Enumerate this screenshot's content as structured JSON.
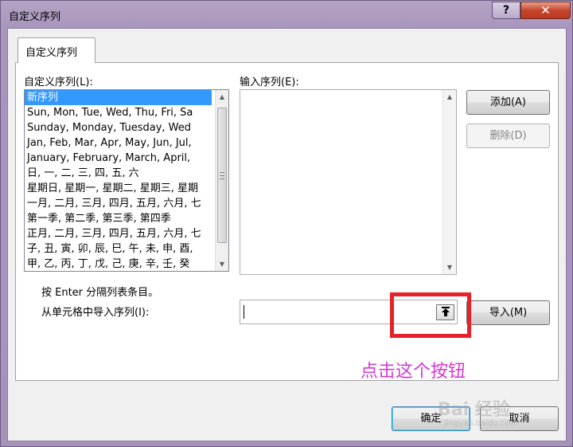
{
  "window": {
    "title": "自定义序列",
    "help_label": "?",
    "close_label": "✕"
  },
  "tab": {
    "label": "自定义序列"
  },
  "custom_list": {
    "label": "自定义序列(L):",
    "items": [
      "新序列",
      "Sun, Mon, Tue, Wed, Thu, Fri, Sa",
      "Sunday, Monday, Tuesday, Wed",
      "Jan, Feb, Mar, Apr, May, Jun, Jul,",
      "January, February, March, April,",
      "日, 一, 二, 三, 四, 五, 六",
      "星期日, 星期一, 星期二, 星期三, 星期",
      "一月, 二月, 三月, 四月, 五月, 六月, 七",
      "第一季, 第二季, 第三季, 第四季",
      "正月, 二月, 三月, 四月, 五月, 六月, 七",
      "子, 丑, 寅, 卯, 辰, 巳, 午, 未, 申, 酉,",
      "甲, 乙, 丙, 丁, 戊, 己, 庚, 辛, 壬, 癸"
    ]
  },
  "entries": {
    "label": "输入序列(E):"
  },
  "buttons": {
    "add": "添加(A)",
    "delete": "删除(D)",
    "import": "导入(M)",
    "ok": "确定",
    "cancel": "取消"
  },
  "hint": "按 Enter 分隔列表条目。",
  "import_label": "从单元格中导入序列(I):",
  "annotation": "点击这个按钮",
  "watermark": {
    "main": "Bai 经验",
    "sub": "jingyan.baidu.com"
  },
  "colors": {
    "selection": "#3399ff",
    "highlight_box": "#e8202a",
    "annotation": "#d43ad0"
  }
}
